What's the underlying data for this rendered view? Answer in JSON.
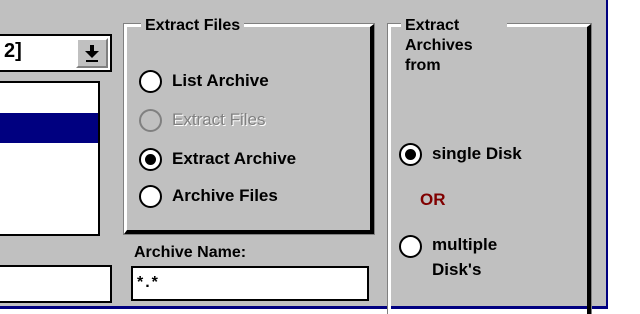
{
  "drive_combo": {
    "value": "2]",
    "dropdown_icon": "arrow-down-to-line-icon"
  },
  "extract_group": {
    "title": "Extract Files",
    "options": [
      {
        "label": "List Archive",
        "checked": false,
        "enabled": true
      },
      {
        "label": "Extract Files",
        "checked": false,
        "enabled": false
      },
      {
        "label": "Extract Archive",
        "checked": true,
        "enabled": true
      },
      {
        "label": "Archive Files",
        "checked": false,
        "enabled": true
      }
    ]
  },
  "archive_name": {
    "label": "Archive Name:",
    "value": "*.*"
  },
  "extract_from_group": {
    "title": "Extract Archives from",
    "single_label": "single Disk",
    "or_text": "OR",
    "multiple_label": "multiple Disk's",
    "selected": "single Disk"
  },
  "colors": {
    "selection": "#000080",
    "or_text": "#800000",
    "window_bg": "#c0c0c0"
  }
}
